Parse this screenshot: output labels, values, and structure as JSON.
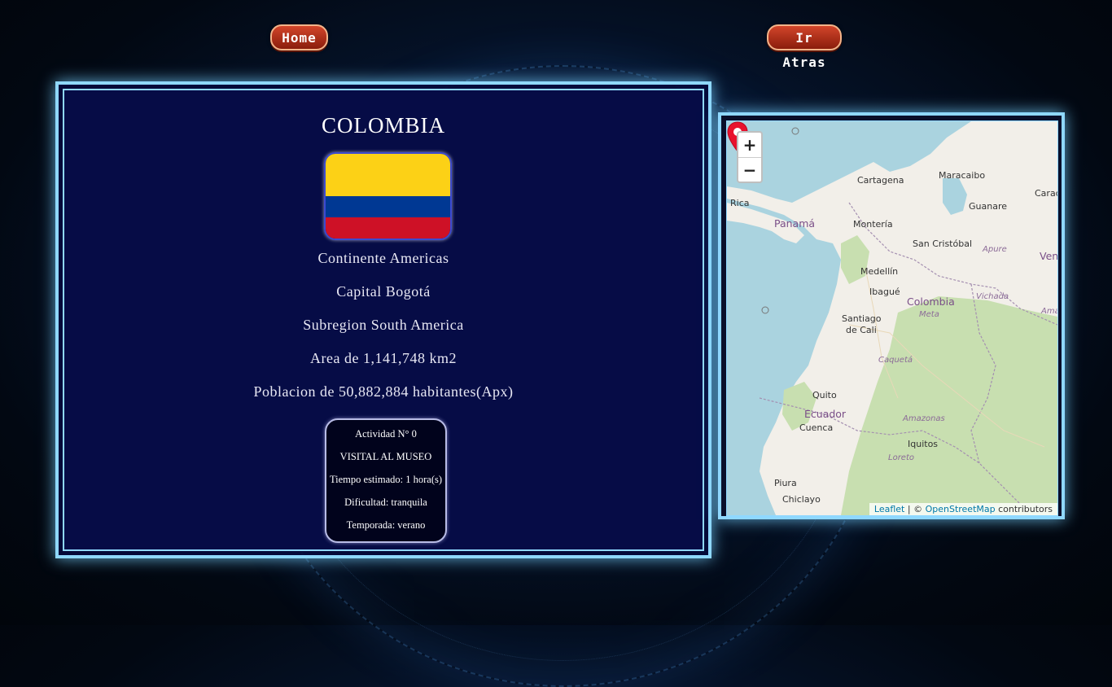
{
  "nav": {
    "home_label": "Home",
    "back_label": "Ir Atras"
  },
  "country": {
    "name": "COLOMBIA",
    "continent": "Continente Americas",
    "capital": "Capital Bogotá",
    "subregion": "Subregion South America",
    "area": "Area de 1,141,748 km2",
    "population": "Poblacion de 50,882,884 habitantes(Apx)",
    "flag_colors": [
      "#fcd116",
      "#003893",
      "#ce1126"
    ]
  },
  "activity": {
    "number": "Actividad N° 0",
    "name": "VISITAL AL MUSEO",
    "time": "Tiempo estimado: 1 hora(s)",
    "difficulty": "Dificultad: tranquila",
    "season": "Temporada: verano"
  },
  "map": {
    "zoom_in": "+",
    "zoom_out": "−",
    "attribution_leaflet": "Leaflet",
    "attribution_sep": " | © ",
    "attribution_osm": "OpenStreetMap",
    "attribution_tail": " contributors",
    "labels": {
      "cartagena": "Cartagena",
      "maracaibo": "Maracaibo",
      "caracas": "Caracas",
      "rica": "Rica",
      "panama": "Panamá",
      "guanare": "Guanare",
      "monteria": "Montería",
      "san_cristobal": "San Cristóbal",
      "apure": "Apure",
      "ven": "Ven",
      "medellin": "Medellín",
      "vichada": "Vichada",
      "ibague": "Ibagué",
      "colombia": "Colombia",
      "santiago": "Santiago",
      "de_cali": "de Cali",
      "meta": "Meta",
      "ama": "Ama.",
      "caqueta": "Caquetá",
      "quito": "Quito",
      "ecuador": "Ecuador",
      "amazonas": "Amazonas",
      "cuenca": "Cuenca",
      "iquitos": "Iquitos",
      "loreto": "Loreto",
      "piura": "Piura",
      "chiclayo": "Chiclayo"
    },
    "colors": {
      "sea": "#aad3df",
      "land": "#f2efe9",
      "forest": "#c8dfb0",
      "marker": "#e8112d"
    }
  }
}
